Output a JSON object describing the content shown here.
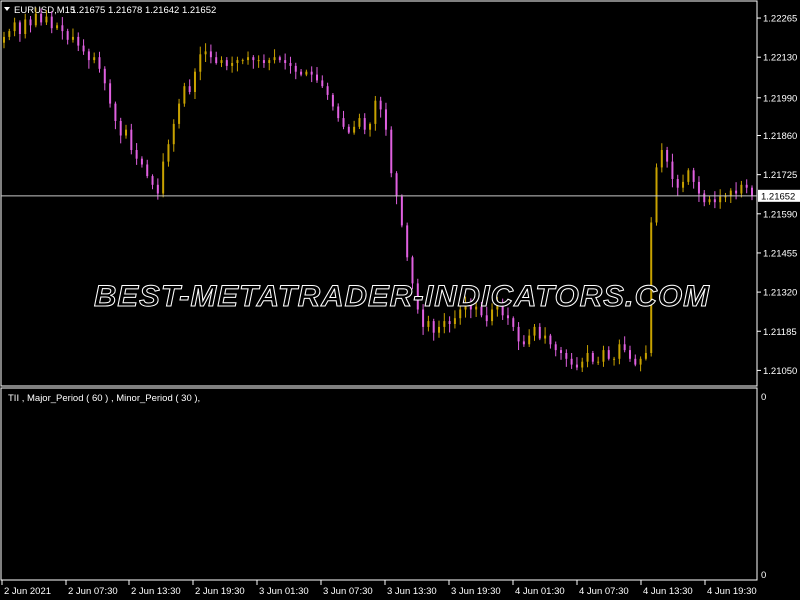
{
  "main": {
    "header": {
      "symbol": "EURUSD,M15",
      "ohlc": "1.21675 1.21678 1.21642 1.21652"
    },
    "y_ticks": [
      "1.22265",
      "1.22130",
      "1.21990",
      "1.21860",
      "1.21725",
      "1.21590",
      "1.21455",
      "1.21320",
      "1.21185",
      "1.21050"
    ],
    "current_price": "1.21652",
    "watermark": "BEST-METATRADER-INDICATORS.COM"
  },
  "indicator": {
    "label": "TII , Major_Period ( 60 ) , Minor_Period ( 30 ),",
    "scale_top": "0",
    "scale_bottom": "0"
  },
  "x_ticks": [
    "2 Jun 2021",
    "2 Jun 07:30",
    "2 Jun 13:30",
    "2 Jun 19:30",
    "3 Jun 01:30",
    "3 Jun 07:30",
    "3 Jun 13:30",
    "3 Jun 19:30",
    "4 Jun 01:30",
    "4 Jun 07:30",
    "4 Jun 13:30",
    "4 Jun 19:30"
  ],
  "colors": {
    "bull": "#c8a200",
    "bear": "#e060e0",
    "background": "#000000",
    "grid": "#ffffff"
  },
  "chart_data": {
    "type": "candlestick",
    "symbol": "EURUSD",
    "timeframe": "M15",
    "ylim": [
      1.2101,
      1.2231
    ],
    "current": 1.21652,
    "closes": [
      1.222,
      1.2222,
      1.2225,
      1.2221,
      1.2226,
      1.2224,
      1.2228,
      1.2225,
      1.2227,
      1.2223,
      1.2224,
      1.2222,
      1.2219,
      1.222,
      1.2217,
      1.2215,
      1.2212,
      1.2213,
      1.2209,
      1.2204,
      1.2197,
      1.2191,
      1.2186,
      1.2188,
      1.2181,
      1.2178,
      1.2176,
      1.2172,
      1.2169,
      1.2166,
      1.2177,
      1.2183,
      1.219,
      1.2197,
      1.2203,
      1.2201,
      1.2208,
      1.2214,
      1.2215,
      1.2213,
      1.2211,
      1.2212,
      1.221,
      1.2211,
      1.2212,
      1.2212,
      1.2213,
      1.2212,
      1.2212,
      1.2211,
      1.2212,
      1.2213,
      1.2212,
      1.2211,
      1.221,
      1.2208,
      1.2207,
      1.2208,
      1.2207,
      1.2205,
      1.2203,
      1.22,
      1.2196,
      1.2192,
      1.2189,
      1.2187,
      1.2189,
      1.2192,
      1.2188,
      1.219,
      1.2198,
      1.2195,
      1.2188,
      1.2173,
      1.2165,
      1.2155,
      1.2144,
      1.2135,
      1.2126,
      1.212,
      1.2122,
      1.2118,
      1.212,
      1.2122,
      1.2121,
      1.2123,
      1.2126,
      1.2128,
      1.2126,
      1.2127,
      1.2124,
      1.2122,
      1.2126,
      1.2128,
      1.2124,
      1.2123,
      1.212,
      1.2115,
      1.2114,
      1.2117,
      1.212,
      1.2116,
      1.2117,
      1.2114,
      1.2112,
      1.2111,
      1.2109,
      1.2107,
      1.2106,
      1.2108,
      1.2111,
      1.2108,
      1.2108,
      1.2112,
      1.2109,
      1.2109,
      1.2114,
      1.2112,
      1.2109,
      1.2107,
      1.2109,
      1.2111,
      1.2156,
      1.2175,
      1.2181,
      1.2177,
      1.2171,
      1.2168,
      1.217,
      1.2174,
      1.217,
      1.2166,
      1.2163,
      1.2164,
      1.2163,
      1.2165,
      1.2165,
      1.2167,
      1.2166,
      1.2169,
      1.2168,
      1.21652
    ]
  }
}
